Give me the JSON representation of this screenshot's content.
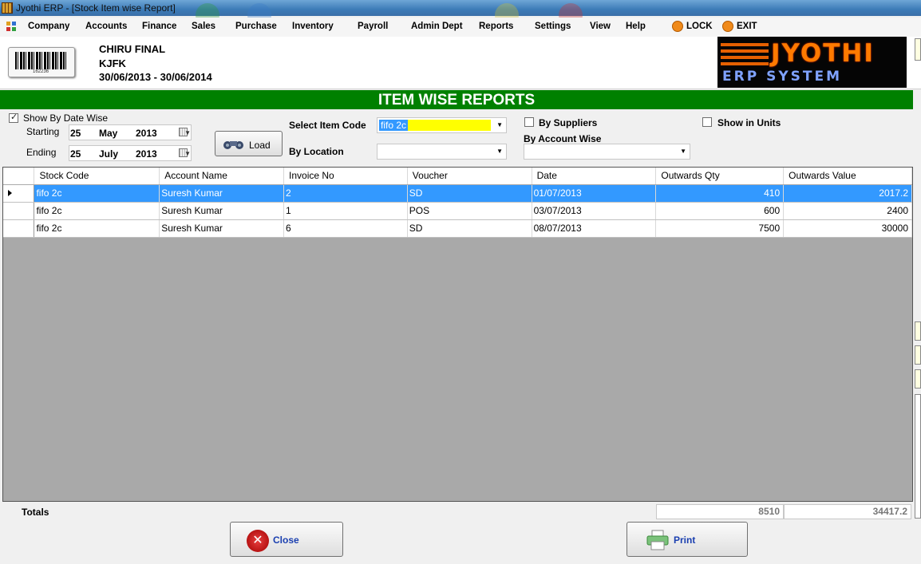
{
  "window": {
    "title": "Jyothi ERP - [Stock Item wise Report]"
  },
  "menu": {
    "items": [
      "Company",
      "Accounts",
      "Finance",
      "Sales",
      "Purchase",
      "Inventory",
      "Payroll",
      "Admin Dept",
      "Reports",
      "Settings",
      "View",
      "Help"
    ],
    "lock": "LOCK",
    "exit": "EXIT"
  },
  "header": {
    "company": "CHIRU FINAL",
    "branch": "KJFK",
    "period": "30/06/2013 - 30/06/2014",
    "barcode_number": "162236",
    "logo_top": "JYOTHI",
    "logo_bottom": "ERP SYSTEM"
  },
  "banner": {
    "title": "ITEM WISE REPORTS"
  },
  "filters": {
    "show_by_date_wise": {
      "label": "Show By Date Wise",
      "checked": true
    },
    "starting": {
      "label": "Starting",
      "day": "25",
      "month": "May",
      "year": "2013"
    },
    "ending": {
      "label": "Ending",
      "day": "25",
      "month": "July",
      "year": "2013"
    },
    "load_label": "Load",
    "select_item_code": {
      "label": "Select Item Code",
      "value": "fifo 2c"
    },
    "by_location": {
      "label": "By Location",
      "value": ""
    },
    "by_suppliers": {
      "label": "By Suppliers",
      "checked": false
    },
    "by_account_wise": {
      "label": "By Account Wise",
      "value": ""
    },
    "show_in_units": {
      "label": "Show in Units",
      "checked": false
    }
  },
  "grid": {
    "columns": [
      "Stock Code",
      "Account Name",
      "Invoice No",
      "Voucher",
      "Date",
      "Outwards Qty",
      "Outwards Value"
    ],
    "rows": [
      [
        "fifo 2c",
        "Suresh Kumar",
        "2",
        "SD",
        "01/07/2013",
        "410",
        "2017.2"
      ],
      [
        "fifo 2c",
        "Suresh Kumar",
        "1",
        "POS",
        "03/07/2013",
        "600",
        "2400"
      ],
      [
        "fifo 2c",
        "Suresh Kumar",
        "6",
        "SD",
        "08/07/2013",
        "7500",
        "30000"
      ]
    ],
    "selected_row": 0
  },
  "totals": {
    "label": "Totals",
    "qty": "8510",
    "value": "34417.2"
  },
  "buttons": {
    "close": "Close",
    "print": "Print"
  },
  "colors": {
    "banner": "#008000",
    "selection": "#3399ff",
    "highlight": "#ffff00"
  }
}
